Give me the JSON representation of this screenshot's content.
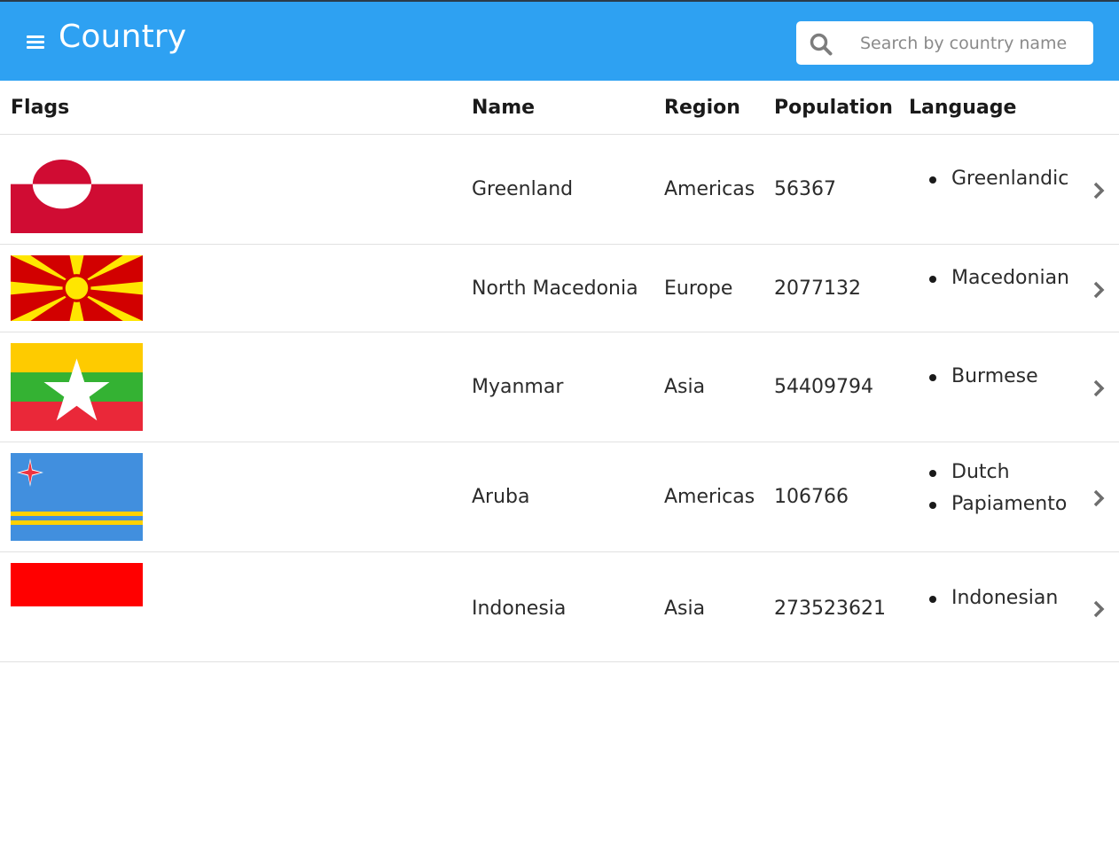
{
  "appbar": {
    "title": "Country",
    "menu_icon": "menu-icon",
    "search_icon": "search-icon",
    "search_placeholder": "Search by country name",
    "search_value": "",
    "color": "#2ea1f2"
  },
  "table": {
    "headers": {
      "flags": "Flags",
      "name": "Name",
      "region": "Region",
      "population": "Population",
      "language": "Language"
    },
    "rows": [
      {
        "name": "Greenland",
        "region": "Americas",
        "population": "56367",
        "languages": [
          "Greenlandic"
        ],
        "flag_icon": "greenland-flag-icon"
      },
      {
        "name": "North Macedonia",
        "region": "Europe",
        "population": "2077132",
        "languages": [
          "Macedonian"
        ],
        "flag_icon": "north-macedonia-flag-icon"
      },
      {
        "name": "Myanmar",
        "region": "Asia",
        "population": "54409794",
        "languages": [
          "Burmese"
        ],
        "flag_icon": "myanmar-flag-icon"
      },
      {
        "name": "Aruba",
        "region": "Americas",
        "population": "106766",
        "languages": [
          "Dutch",
          "Papiamento"
        ],
        "flag_icon": "aruba-flag-icon"
      },
      {
        "name": "Indonesia",
        "region": "Asia",
        "population": "273523621",
        "languages": [
          "Indonesian"
        ],
        "flag_icon": "indonesia-flag-icon"
      }
    ],
    "row_action_icon": "chevron-right-icon"
  }
}
